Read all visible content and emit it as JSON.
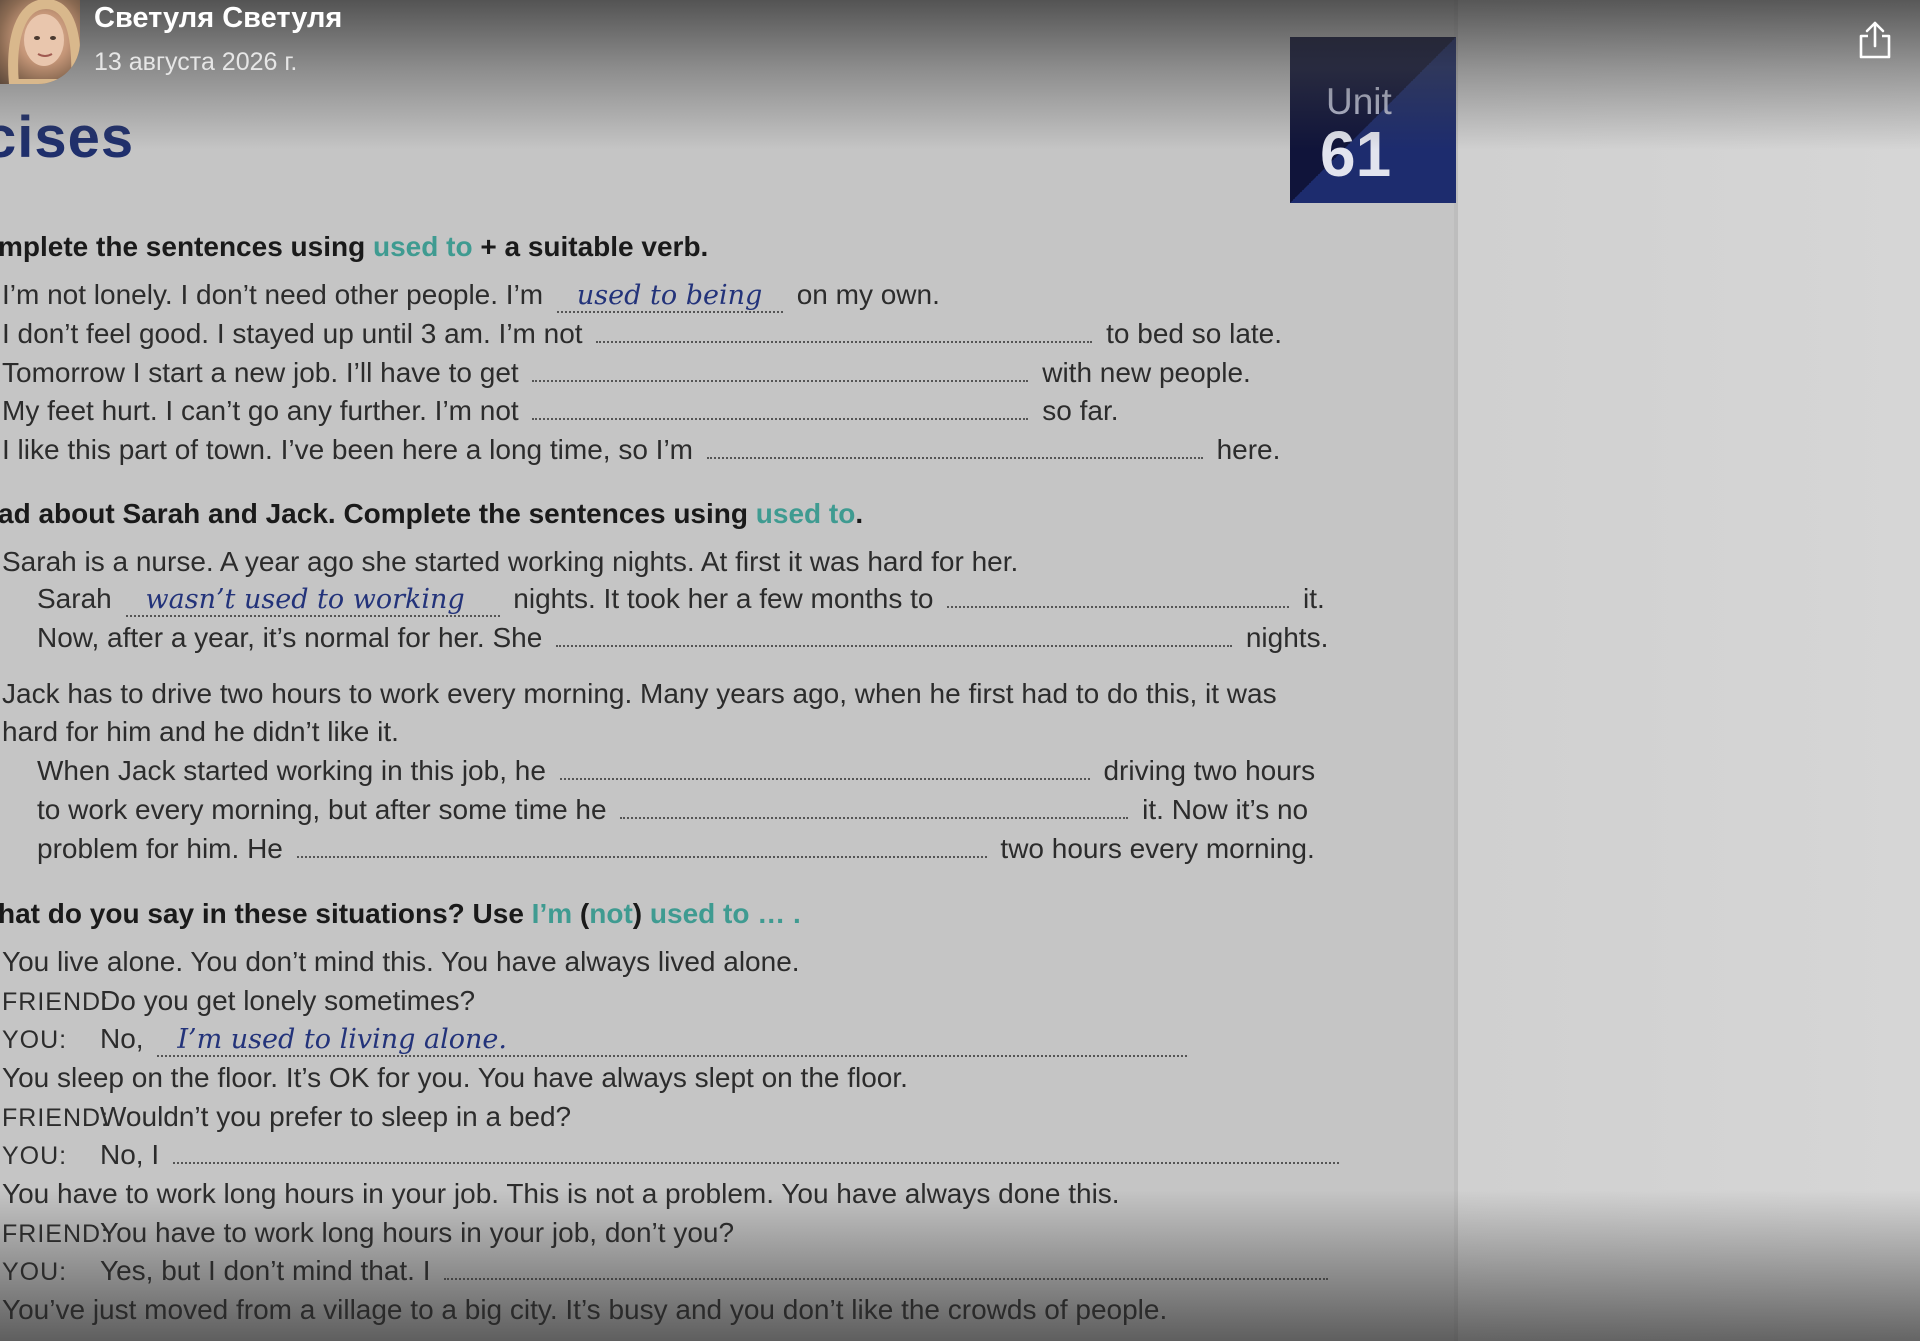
{
  "header": {
    "author_name": "Светуля Светуля",
    "date": "13 августа 2026 г."
  },
  "icons": {
    "share": "share-icon",
    "avatar": "avatar"
  },
  "colors": {
    "accent": "#3f9b91",
    "handwriting": "#23337a",
    "unit_box": "#1d2c6e",
    "heading": "#1f2f6c"
  },
  "page": {
    "heading": "cises",
    "unit": {
      "word": "Unit",
      "number": "61"
    },
    "section1": {
      "heading_pre": "mplete the sentences using ",
      "heading_hl": "used to",
      "heading_post": " + a suitable verb.",
      "lines": [
        {
          "pre": "I’m not lonely.  I don’t need other people.  I’m ",
          "answer": "used to being",
          "post": " on my own."
        },
        {
          "pre": "I don’t feel good.  I stayed up until 3 am.  I’m not ",
          "post": " to bed so late."
        },
        {
          "pre": "Tomorrow I start a new job.  I’ll have to get ",
          "post": " with new people."
        },
        {
          "pre": "My feet hurt.  I can’t go any further.  I’m not ",
          "post": " so far."
        },
        {
          "pre": "I like this part of town.  I’ve been here a long time, so I’m ",
          "post": " here."
        }
      ]
    },
    "section2": {
      "heading_pre": "ad about Sarah and Jack.  Complete the sentences using ",
      "heading_hl": "used to",
      "heading_post": ".",
      "sarah_intro": "Sarah is a nurse.  A year ago she started working nights.  At first it was hard for her.",
      "sarah_l1_pre": "Sarah ",
      "sarah_l1_answer": "wasn’t used to working",
      "sarah_l1_mid": " nights.  It took her a few months to ",
      "sarah_l1_post": " it.",
      "sarah_l2_pre": "Now, after a year, it’s normal for her.  She ",
      "sarah_l2_post": " nights.",
      "jack_intro1": "Jack has to drive two hours to work every morning.  Many years ago, when he first had to do this, it was",
      "jack_intro2": "hard for him and he didn’t like it.",
      "jack_l1_pre": "When Jack started working in this job, he ",
      "jack_l1_post": " driving two hours",
      "jack_l2_pre": "to work every morning, but after some time he ",
      "jack_l2_post": " it.  Now it’s no",
      "jack_l3_pre": "problem for him.  He ",
      "jack_l3_post": " two hours every morning."
    },
    "section3": {
      "heading_pre": "hat do you say in these situations?  Use ",
      "heading_hl1": "I’m",
      "heading_mid1": " (",
      "heading_hl2": "not",
      "heading_mid2": ") ",
      "heading_hl3": "used to … .",
      "friend_label": "FRIEND:",
      "you_label": "YOU:",
      "s1_intro": "You live alone.  You don’t mind this.  You have always lived alone.",
      "s1_friend": "Do you get lonely sometimes?",
      "s1_you_pre": "No, ",
      "s1_you_answer": "I’m used to living alone.",
      "s2_intro": "You sleep on the floor.  It’s OK for you.  You have always slept on the floor.",
      "s2_friend": "Wouldn’t you prefer to sleep in a bed?",
      "s2_you_pre": "No, I ",
      "s3_intro": "You have to work long hours in your job.  This is not a problem.  You have always done this.",
      "s3_friend": "You have to work long hours in your job, don’t you?",
      "s3_you_pre": "Yes, but I don’t mind that.  I ",
      "s4_intro": "You’ve just moved from a village to a big city.  It’s busy and you don’t like the crowds of people."
    }
  }
}
